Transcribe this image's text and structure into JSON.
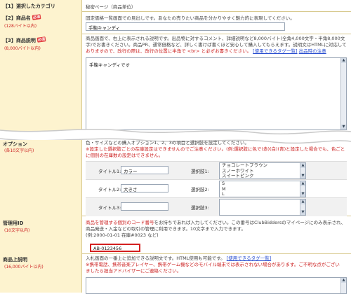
{
  "rows": {
    "category": {
      "label": "【1】選択したカテゴリ",
      "value": "秘密ページ（商品単位）"
    },
    "product_name": {
      "label": "【2】商品名",
      "badge": "必須",
      "limit": "(128バイト以内)",
      "desc": "固定価格一覧画面での見出しです。あなたの売りたい商品を分かりやすく魅力的に表現してください。",
      "value": "手鞠キャンディ"
    },
    "product_desc": {
      "label": "【3】商品説明",
      "badge": "必須",
      "limit": "(8,000バイト以内)",
      "desc1": "商品画面で、右上に表示される説明です。出品物に対するコメント、詳細説明など8,000バイト(全角4,000文字・半角8,000文字)でお書きください。商品PR、通常価格など、詳しく書けば書くほど安心して購入してもらえます。説明文はHTMLに対応して",
      "desc2": "おりますので、改行の際は、改行の位置に半角で <br> と必ずお書きください。",
      "tag_link": "[使用できるタグ一覧]",
      "notes_link": "出品時の注意",
      "value": "手鞠キャンディです"
    },
    "options": {
      "label": "オプション",
      "limit": "(各10文字以内)",
      "desc1": "色・サイズなどの購入オプション1、2、3の項目と選択肢を設定してください。",
      "desc2": "※設定した選択肢ごとの在庫設定はできませんのでご注意ください。(例:選択肢に色で(赤)(白)(青)と設定した場合でも、色ごとに個別の在庫数の設定はできません。",
      "title1_label": "タイトル1:",
      "title1_value": "カラー",
      "title2_label": "タイトル2:",
      "title2_value": "大きさ",
      "title3_label": "タイトル3:",
      "title3_value": "",
      "choice1_label": "選択肢1:",
      "choice1_values": [
        "チョコレートブラウン",
        "スノーホワイト",
        "スイートピンク"
      ],
      "choice2_label": "選択肢2:",
      "choice2_values": [
        "S",
        "M",
        "L"
      ],
      "choice3_label": "選択肢3:",
      "choice3_values": []
    },
    "manage_id": {
      "label": "管理用ID",
      "limit": "(10文字以内)",
      "desc1_red": "商品を管理する個別のコード番号",
      "desc1": "をお持ちであれば入力してください。この番号はClubBiddersのマイページにのみ表示され、",
      "desc2": "商品発送・入金などの取引の管理に利用できます。10文字まで入力できます。",
      "desc3": "(例:2000-01-01  在庫#0023 など)",
      "value": "AB-0123456"
    },
    "top_desc": {
      "label": "商品上説明",
      "limit": "(16,000バイト以内)",
      "desc1": "入札画面の一番上に追加できる説明文です。HTML使用も可能です。",
      "tag_link": "[使用できるタグ一覧]",
      "warn1": "※携帯電話、携帯音楽プレイヤー、携帯ゲーム機などのモバイル端末では表示されない場合があります。ご不明な点がござい",
      "warn2": "ましたら担当アドバイザーにご連絡ください。"
    }
  }
}
